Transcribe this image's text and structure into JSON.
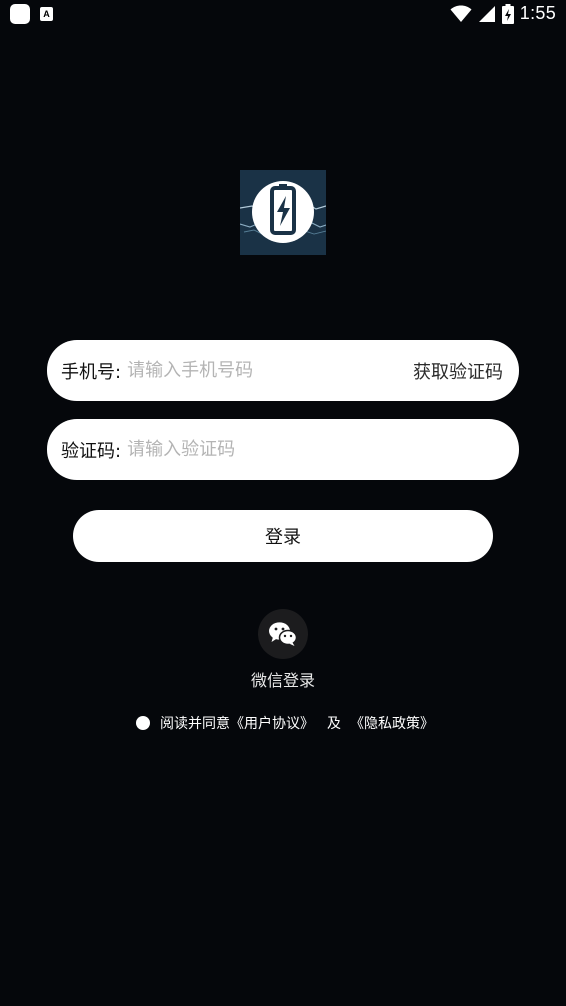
{
  "status_bar": {
    "time": "1:55",
    "icons": [
      "app-square-icon",
      "a-notification-icon",
      "wifi-icon",
      "signal-icon",
      "battery-charging-icon"
    ]
  },
  "logo": {
    "icon": "battery-charging-icon",
    "colors": {
      "background": "#1a3246",
      "circle": "#ffffff",
      "accent": "#1a3246"
    }
  },
  "phone_field": {
    "label": "手机号:",
    "placeholder": "请输入手机号码",
    "value": "",
    "get_code_label": "获取验证码"
  },
  "code_field": {
    "label": "验证码:",
    "placeholder": "请输入验证码",
    "value": ""
  },
  "login_button": {
    "label": "登录"
  },
  "wechat_login": {
    "icon": "wechat-icon",
    "label": "微信登录"
  },
  "agreement": {
    "prefix": "阅读并同意",
    "user_agreement": "《用户协议》",
    "and": "及",
    "privacy_policy": "《隐私政策》",
    "checked": false
  },
  "colors": {
    "page_background": "#05070b",
    "field_background": "#ffffff",
    "placeholder": "#b4b4b4",
    "text_dark": "#111111"
  }
}
